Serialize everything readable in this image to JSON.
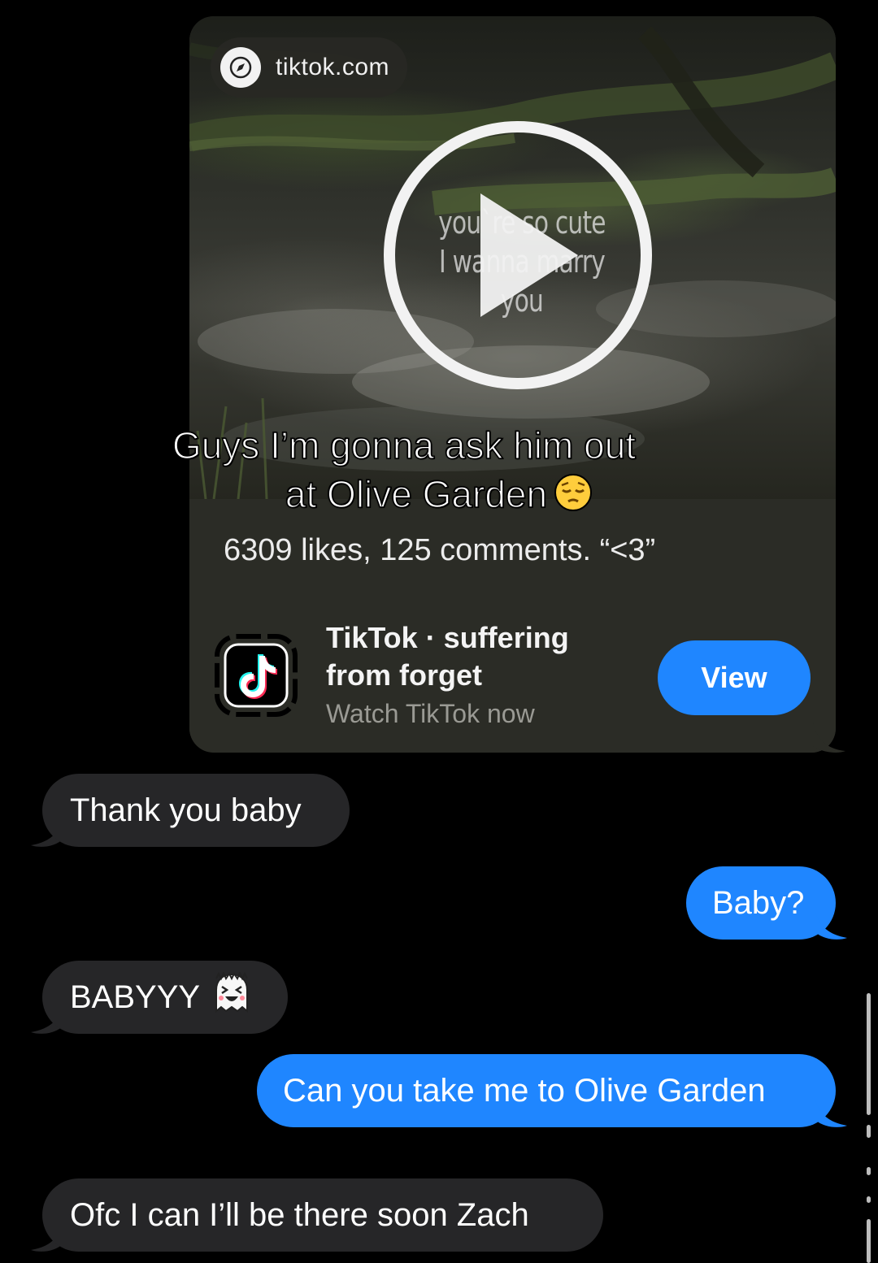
{
  "link_preview": {
    "domain": "tiktok.com",
    "video_caption_line1": "you`re so cute",
    "video_caption_line2": "I wanna marry you",
    "stats": "6309 likes, 125 comments. “<3”",
    "app_title": "TikTok · suffering from forget",
    "app_subtitle": "Watch TikTok now",
    "view_label": "View"
  },
  "overlay_caption": {
    "line1": "Guys I’m gonna ask him out",
    "line2": "at Olive Garden"
  },
  "messages": [
    {
      "direction": "incoming",
      "text": "Thank you baby"
    },
    {
      "direction": "outgoing",
      "text": "Baby?"
    },
    {
      "direction": "incoming",
      "text": "BABYYY"
    },
    {
      "direction": "outgoing",
      "text": "Can you take me to Olive Garden"
    },
    {
      "direction": "incoming",
      "text": "Ofc I can I’ll be there soon Zach"
    }
  ],
  "colors": {
    "background": "#000000",
    "incoming_bubble": "#262628",
    "outgoing_bubble": "#1f86ff",
    "card_background": "#2b2c26"
  },
  "icons": [
    "compass-icon",
    "play-icon",
    "tiktok-icon",
    "pensive-face-emoji",
    "ghost-emoji"
  ]
}
